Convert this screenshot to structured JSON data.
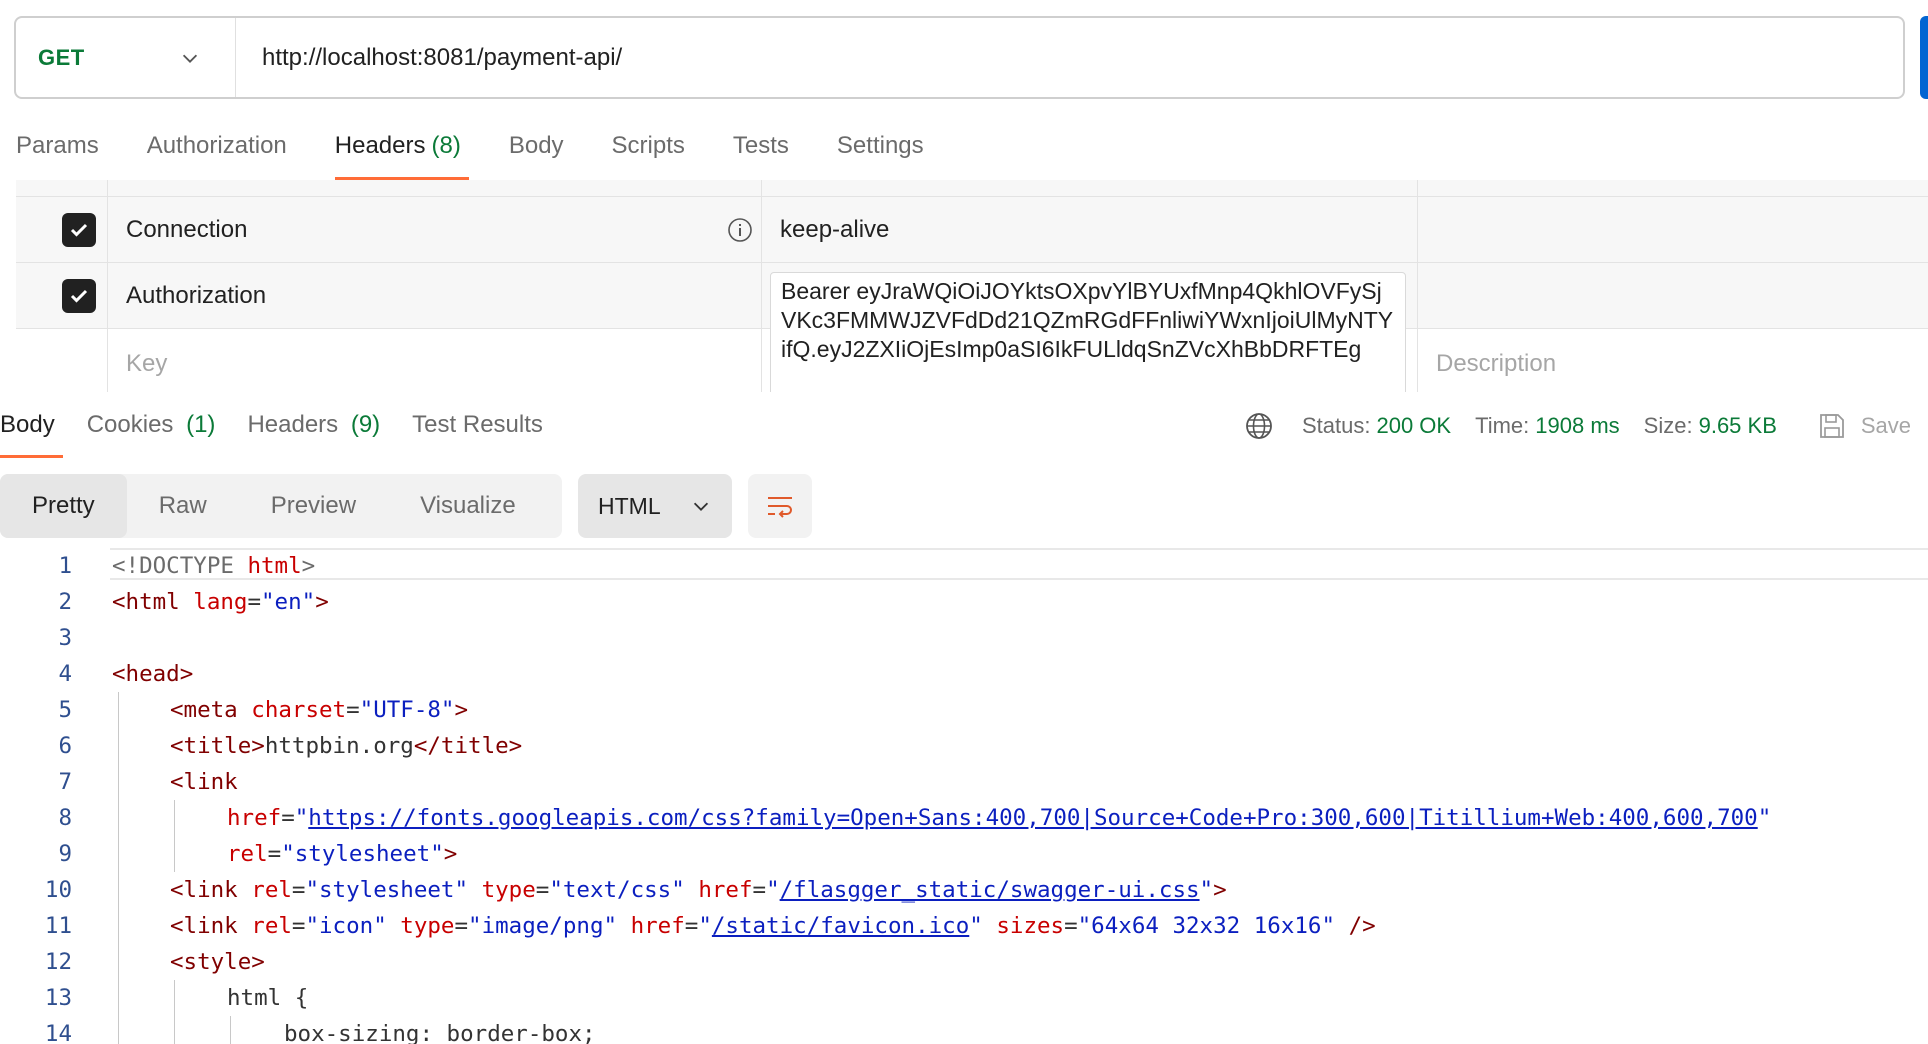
{
  "request": {
    "method": "GET",
    "url": "http://localhost:8081/payment-api/"
  },
  "request_tabs": [
    {
      "label": "Params",
      "count": ""
    },
    {
      "label": "Authorization",
      "count": ""
    },
    {
      "label": "Headers",
      "count": "(8)"
    },
    {
      "label": "Body",
      "count": ""
    },
    {
      "label": "Scripts",
      "count": ""
    },
    {
      "label": "Tests",
      "count": ""
    },
    {
      "label": "Settings",
      "count": ""
    }
  ],
  "headers_table": {
    "rows": [
      {
        "key": "Connection",
        "value": "keep-alive",
        "checked": true
      },
      {
        "key": "Authorization",
        "value": "Bearer eyJraWQiOiJOYktsOXpvYlBYUxfMnp4QkhlOVFySjVKc3FMMWJZVFdDd21QZmRGdFFnliwiYWxnIjoiUlMyNTYifQ.eyJ2ZXIiOjEsImp0aSI6IkFULldqSnZVcXhBbDRFTEg",
        "checked": true
      }
    ],
    "key_placeholder": "Key",
    "description_placeholder": "Description"
  },
  "response_tabs": [
    {
      "label": "Body",
      "count": ""
    },
    {
      "label": "Cookies",
      "count": "(1)"
    },
    {
      "label": "Headers",
      "count": "(9)"
    },
    {
      "label": "Test Results",
      "count": ""
    }
  ],
  "response_meta": {
    "status_label": "Status:",
    "status_value": "200 OK",
    "time_label": "Time:",
    "time_value": "1908 ms",
    "size_label": "Size:",
    "size_value": "9.65 KB",
    "save_label": "Save"
  },
  "view_modes": [
    "Pretty",
    "Raw",
    "Preview",
    "Visualize"
  ],
  "format": "HTML",
  "code_lines": [
    {
      "n": "1"
    },
    {
      "n": "2"
    },
    {
      "n": "3"
    },
    {
      "n": "4"
    },
    {
      "n": "5"
    },
    {
      "n": "6"
    },
    {
      "n": "7"
    },
    {
      "n": "8"
    },
    {
      "n": "9"
    },
    {
      "n": "10"
    },
    {
      "n": "11"
    },
    {
      "n": "12"
    },
    {
      "n": "13"
    },
    {
      "n": "14"
    }
  ],
  "code": {
    "doctype_open": "<!DOCTYPE ",
    "doctype_name": "html",
    "doctype_close": ">",
    "html_tag": "<html",
    "lang_attr": "lang",
    "lang_val": "\"en\"",
    "head_tag": "<head>",
    "meta_tag": "<meta",
    "charset_attr": "charset",
    "charset_val": "\"UTF-8\"",
    "title_open": "<title>",
    "title_text": "httpbin.org",
    "title_close": "</title>",
    "link_tag": "<link",
    "href_attr": "href",
    "fonts_url": "https://fonts.googleapis.com/css?family=Open+Sans:400,700|Source+Code+Pro:300,600|Titillium+Web:400,600,700",
    "rel_attr": "rel",
    "stylesheet_val": "\"stylesheet\"",
    "type_attr": "type",
    "textcss_val": "\"text/css\"",
    "swagger_url": "/flasgger_static/swagger-ui.css",
    "icon_val": "\"icon\"",
    "png_val": "\"image/png\"",
    "favicon_url": "/static/favicon.ico",
    "sizes_attr": "sizes",
    "sizes_val": "\"64x64 32x32 16x16\"",
    "style_tag": "<style>",
    "html_sel": "html {",
    "box_sizing": "box-sizing: border-box;"
  }
}
